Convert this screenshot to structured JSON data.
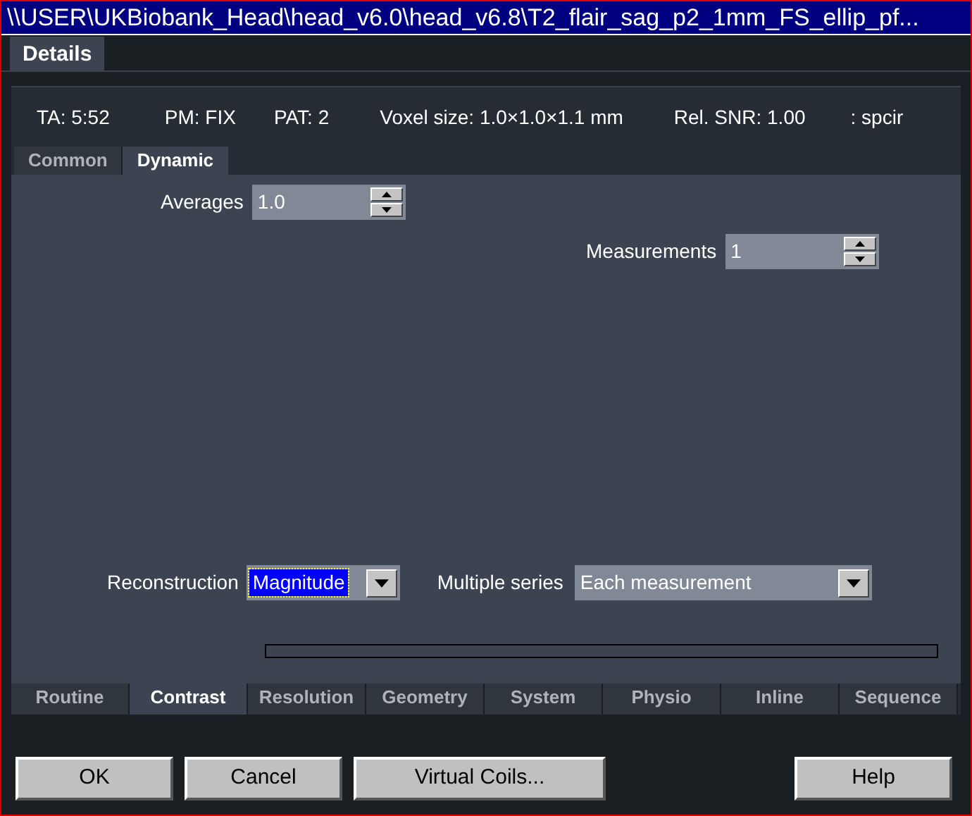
{
  "window": {
    "title": "\\\\USER\\UKBiobank_Head\\head_v6.0\\head_v6.8\\T2_flair_sag_p2_1mm_FS_ellip_pf..."
  },
  "top_tabs": [
    {
      "label": "Details",
      "selected": true
    }
  ],
  "info": [
    "TA: 5:52",
    "PM: FIX",
    "PAT: 2",
    "Voxel size: 1.0×1.0×1.1 mm",
    "Rel. SNR: 1.00",
    ": spcir"
  ],
  "sub_tabs": [
    {
      "label": "Common",
      "selected": false
    },
    {
      "label": "Dynamic",
      "selected": true
    }
  ],
  "spinners": [
    {
      "label": "Averages",
      "value": "1.0"
    },
    {
      "label": "Measurements",
      "value": "1"
    }
  ],
  "dropdowns": [
    {
      "label": "Reconstruction",
      "value": "Magnitude",
      "focused": true
    },
    {
      "label": "Multiple series",
      "value": "Each measurement",
      "focused": false
    }
  ],
  "bottom_tabs": [
    {
      "label": "Routine",
      "selected": false
    },
    {
      "label": "Contrast",
      "selected": true
    },
    {
      "label": "Resolution",
      "selected": false
    },
    {
      "label": "Geometry",
      "selected": false
    },
    {
      "label": "System",
      "selected": false
    },
    {
      "label": "Physio",
      "selected": false
    },
    {
      "label": "Inline",
      "selected": false
    },
    {
      "label": "Sequence",
      "selected": false
    }
  ],
  "buttons": [
    "OK",
    "Cancel",
    "Virtual Coils...",
    "Help"
  ]
}
